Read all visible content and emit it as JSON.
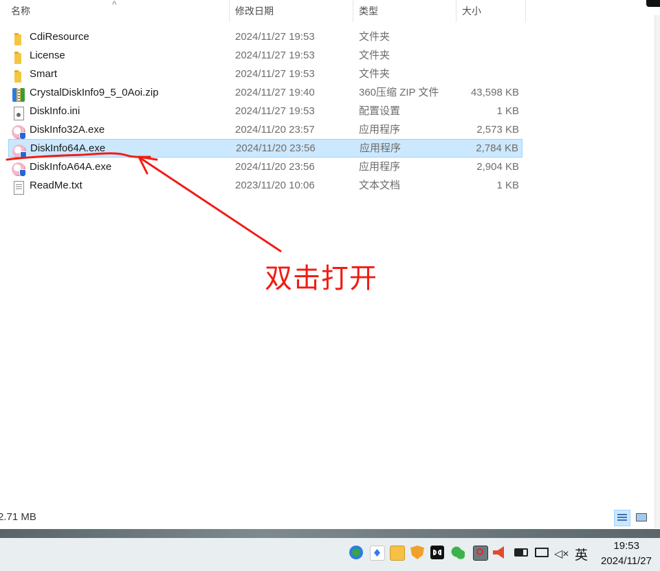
{
  "columns": {
    "name": "名称",
    "date": "修改日期",
    "type": "类型",
    "size": "大小"
  },
  "files": [
    {
      "name": "CdiResource",
      "date": "2024/11/27 19:53",
      "type": "文件夹",
      "size": "",
      "icon": "folder-icon"
    },
    {
      "name": "License",
      "date": "2024/11/27 19:53",
      "type": "文件夹",
      "size": "",
      "icon": "folder-icon"
    },
    {
      "name": "Smart",
      "date": "2024/11/27 19:53",
      "type": "文件夹",
      "size": "",
      "icon": "folder-icon"
    },
    {
      "name": "CrystalDiskInfo9_5_0Aoi.zip",
      "date": "2024/11/27 19:40",
      "type": "360压缩 ZIP 文件",
      "size": "43,598 KB",
      "icon": "zip-archive-icon"
    },
    {
      "name": "DiskInfo.ini",
      "date": "2024/11/27 19:53",
      "type": "配置设置",
      "size": "1 KB",
      "icon": "settings-file-icon"
    },
    {
      "name": "DiskInfo32A.exe",
      "date": "2024/11/20 23:57",
      "type": "应用程序",
      "size": "2,573 KB",
      "icon": "app-icon"
    },
    {
      "name": "DiskInfo64A.exe",
      "date": "2024/11/20 23:56",
      "type": "应用程序",
      "size": "2,784 KB",
      "icon": "app-icon",
      "selected": true
    },
    {
      "name": "DiskInfoA64A.exe",
      "date": "2024/11/20 23:56",
      "type": "应用程序",
      "size": "2,904 KB",
      "icon": "app-icon"
    },
    {
      "name": "ReadMe.txt",
      "date": "2023/11/20 10:06",
      "type": "文本文档",
      "size": "1 KB",
      "icon": "text-file-icon"
    }
  ],
  "annotation": {
    "text": "双击打开",
    "color": "#f01d14"
  },
  "status_bar": {
    "selected_size": "2.71 MB"
  },
  "taskbar": {
    "ime": "英",
    "time": "19:53",
    "date": "2024/11/27",
    "tray_icons": [
      "network-globe-icon",
      "feishu-icon",
      "file-manager-icon",
      "security-shield-icon",
      "dolby-icon",
      "wechat-icon",
      "blocked-screen-icon",
      "speaker-icon",
      "battery-icon",
      "monitor-icon",
      "mute-icon"
    ]
  },
  "accent": "#cce8ff"
}
